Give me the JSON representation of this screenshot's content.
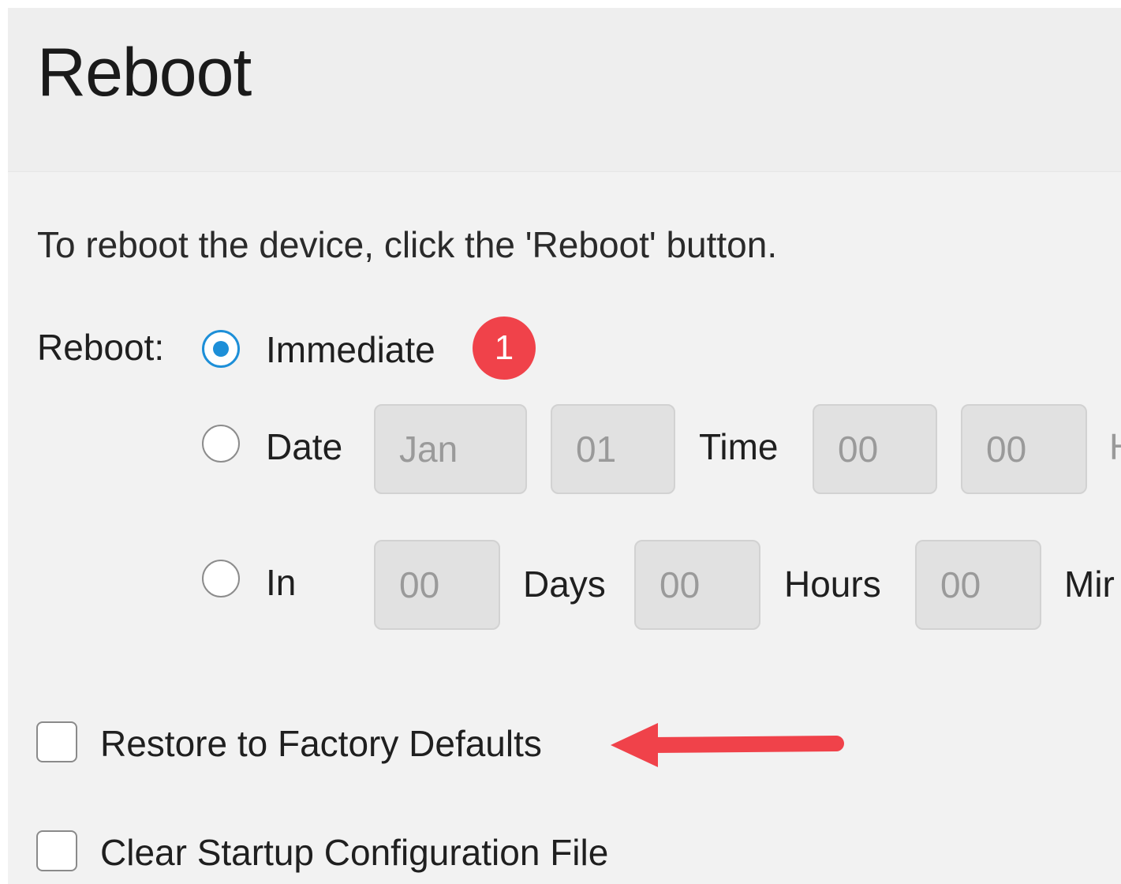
{
  "page": {
    "title": "Reboot",
    "description": "To reboot the device, click the 'Reboot' button."
  },
  "reboot": {
    "label": "Reboot:",
    "selected_option": "Immediate",
    "options": {
      "immediate": {
        "label": "Immediate",
        "checked": true,
        "badge": "1"
      },
      "date": {
        "label": "Date",
        "checked": false,
        "month": "Jan",
        "day": "01",
        "time_label": "Time",
        "hour": "00",
        "minute": "00",
        "trailing_label": "H"
      },
      "in": {
        "label": "In",
        "checked": false,
        "days_value": "00",
        "days_label": "Days",
        "hours_value": "00",
        "hours_label": "Hours",
        "minutes_value": "00",
        "minutes_label": "Mir"
      }
    }
  },
  "options": {
    "restore_factory_defaults": {
      "label": "Restore to Factory Defaults",
      "checked": false
    },
    "clear_startup_config": {
      "label": "Clear Startup Configuration File",
      "checked": false
    }
  },
  "annotation_colors": {
    "badge": "#f0424a",
    "arrow": "#f0424a",
    "radio_accent": "#1d8fd8"
  }
}
